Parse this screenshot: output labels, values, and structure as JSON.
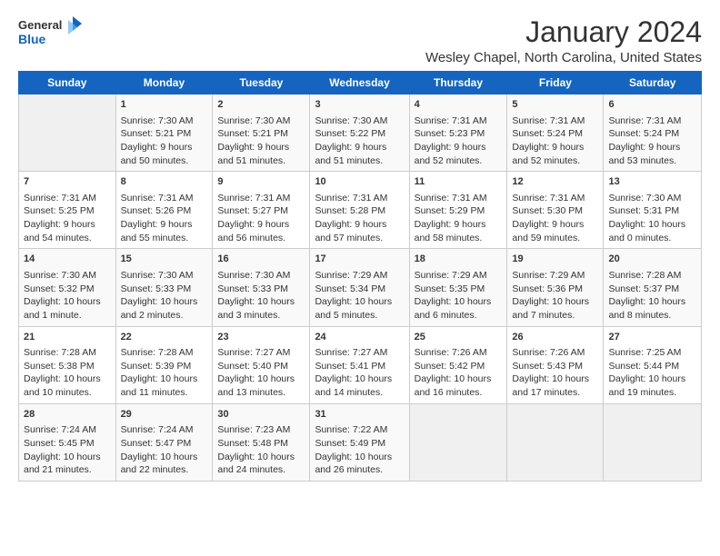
{
  "logo": {
    "line1": "General",
    "line2": "Blue"
  },
  "title": "January 2024",
  "subtitle": "Wesley Chapel, North Carolina, United States",
  "days_of_week": [
    "Sunday",
    "Monday",
    "Tuesday",
    "Wednesday",
    "Thursday",
    "Friday",
    "Saturday"
  ],
  "weeks": [
    [
      {
        "day": "",
        "sunrise": "",
        "sunset": "",
        "daylight": ""
      },
      {
        "day": "1",
        "sunrise": "Sunrise: 7:30 AM",
        "sunset": "Sunset: 5:21 PM",
        "daylight": "Daylight: 9 hours and 50 minutes."
      },
      {
        "day": "2",
        "sunrise": "Sunrise: 7:30 AM",
        "sunset": "Sunset: 5:21 PM",
        "daylight": "Daylight: 9 hours and 51 minutes."
      },
      {
        "day": "3",
        "sunrise": "Sunrise: 7:30 AM",
        "sunset": "Sunset: 5:22 PM",
        "daylight": "Daylight: 9 hours and 51 minutes."
      },
      {
        "day": "4",
        "sunrise": "Sunrise: 7:31 AM",
        "sunset": "Sunset: 5:23 PM",
        "daylight": "Daylight: 9 hours and 52 minutes."
      },
      {
        "day": "5",
        "sunrise": "Sunrise: 7:31 AM",
        "sunset": "Sunset: 5:24 PM",
        "daylight": "Daylight: 9 hours and 52 minutes."
      },
      {
        "day": "6",
        "sunrise": "Sunrise: 7:31 AM",
        "sunset": "Sunset: 5:24 PM",
        "daylight": "Daylight: 9 hours and 53 minutes."
      }
    ],
    [
      {
        "day": "7",
        "sunrise": "Sunrise: 7:31 AM",
        "sunset": "Sunset: 5:25 PM",
        "daylight": "Daylight: 9 hours and 54 minutes."
      },
      {
        "day": "8",
        "sunrise": "Sunrise: 7:31 AM",
        "sunset": "Sunset: 5:26 PM",
        "daylight": "Daylight: 9 hours and 55 minutes."
      },
      {
        "day": "9",
        "sunrise": "Sunrise: 7:31 AM",
        "sunset": "Sunset: 5:27 PM",
        "daylight": "Daylight: 9 hours and 56 minutes."
      },
      {
        "day": "10",
        "sunrise": "Sunrise: 7:31 AM",
        "sunset": "Sunset: 5:28 PM",
        "daylight": "Daylight: 9 hours and 57 minutes."
      },
      {
        "day": "11",
        "sunrise": "Sunrise: 7:31 AM",
        "sunset": "Sunset: 5:29 PM",
        "daylight": "Daylight: 9 hours and 58 minutes."
      },
      {
        "day": "12",
        "sunrise": "Sunrise: 7:31 AM",
        "sunset": "Sunset: 5:30 PM",
        "daylight": "Daylight: 9 hours and 59 minutes."
      },
      {
        "day": "13",
        "sunrise": "Sunrise: 7:30 AM",
        "sunset": "Sunset: 5:31 PM",
        "daylight": "Daylight: 10 hours and 0 minutes."
      }
    ],
    [
      {
        "day": "14",
        "sunrise": "Sunrise: 7:30 AM",
        "sunset": "Sunset: 5:32 PM",
        "daylight": "Daylight: 10 hours and 1 minute."
      },
      {
        "day": "15",
        "sunrise": "Sunrise: 7:30 AM",
        "sunset": "Sunset: 5:33 PM",
        "daylight": "Daylight: 10 hours and 2 minutes."
      },
      {
        "day": "16",
        "sunrise": "Sunrise: 7:30 AM",
        "sunset": "Sunset: 5:33 PM",
        "daylight": "Daylight: 10 hours and 3 minutes."
      },
      {
        "day": "17",
        "sunrise": "Sunrise: 7:29 AM",
        "sunset": "Sunset: 5:34 PM",
        "daylight": "Daylight: 10 hours and 5 minutes."
      },
      {
        "day": "18",
        "sunrise": "Sunrise: 7:29 AM",
        "sunset": "Sunset: 5:35 PM",
        "daylight": "Daylight: 10 hours and 6 minutes."
      },
      {
        "day": "19",
        "sunrise": "Sunrise: 7:29 AM",
        "sunset": "Sunset: 5:36 PM",
        "daylight": "Daylight: 10 hours and 7 minutes."
      },
      {
        "day": "20",
        "sunrise": "Sunrise: 7:28 AM",
        "sunset": "Sunset: 5:37 PM",
        "daylight": "Daylight: 10 hours and 8 minutes."
      }
    ],
    [
      {
        "day": "21",
        "sunrise": "Sunrise: 7:28 AM",
        "sunset": "Sunset: 5:38 PM",
        "daylight": "Daylight: 10 hours and 10 minutes."
      },
      {
        "day": "22",
        "sunrise": "Sunrise: 7:28 AM",
        "sunset": "Sunset: 5:39 PM",
        "daylight": "Daylight: 10 hours and 11 minutes."
      },
      {
        "day": "23",
        "sunrise": "Sunrise: 7:27 AM",
        "sunset": "Sunset: 5:40 PM",
        "daylight": "Daylight: 10 hours and 13 minutes."
      },
      {
        "day": "24",
        "sunrise": "Sunrise: 7:27 AM",
        "sunset": "Sunset: 5:41 PM",
        "daylight": "Daylight: 10 hours and 14 minutes."
      },
      {
        "day": "25",
        "sunrise": "Sunrise: 7:26 AM",
        "sunset": "Sunset: 5:42 PM",
        "daylight": "Daylight: 10 hours and 16 minutes."
      },
      {
        "day": "26",
        "sunrise": "Sunrise: 7:26 AM",
        "sunset": "Sunset: 5:43 PM",
        "daylight": "Daylight: 10 hours and 17 minutes."
      },
      {
        "day": "27",
        "sunrise": "Sunrise: 7:25 AM",
        "sunset": "Sunset: 5:44 PM",
        "daylight": "Daylight: 10 hours and 19 minutes."
      }
    ],
    [
      {
        "day": "28",
        "sunrise": "Sunrise: 7:24 AM",
        "sunset": "Sunset: 5:45 PM",
        "daylight": "Daylight: 10 hours and 21 minutes."
      },
      {
        "day": "29",
        "sunrise": "Sunrise: 7:24 AM",
        "sunset": "Sunset: 5:47 PM",
        "daylight": "Daylight: 10 hours and 22 minutes."
      },
      {
        "day": "30",
        "sunrise": "Sunrise: 7:23 AM",
        "sunset": "Sunset: 5:48 PM",
        "daylight": "Daylight: 10 hours and 24 minutes."
      },
      {
        "day": "31",
        "sunrise": "Sunrise: 7:22 AM",
        "sunset": "Sunset: 5:49 PM",
        "daylight": "Daylight: 10 hours and 26 minutes."
      },
      {
        "day": "",
        "sunrise": "",
        "sunset": "",
        "daylight": ""
      },
      {
        "day": "",
        "sunrise": "",
        "sunset": "",
        "daylight": ""
      },
      {
        "day": "",
        "sunrise": "",
        "sunset": "",
        "daylight": ""
      }
    ]
  ]
}
